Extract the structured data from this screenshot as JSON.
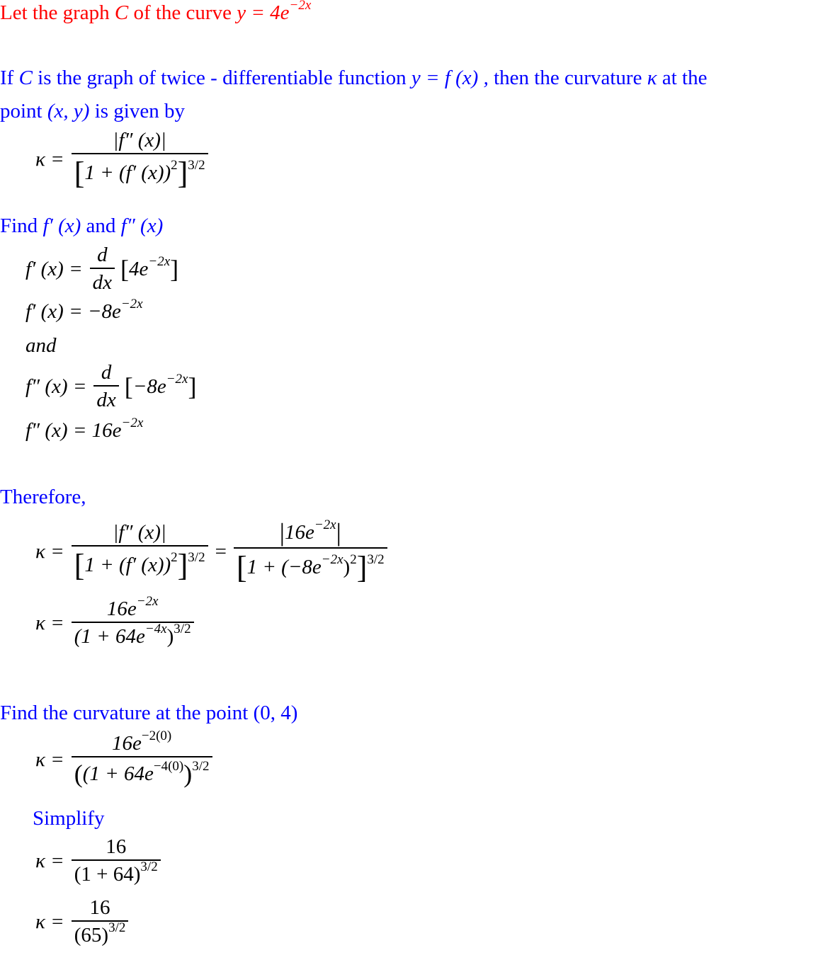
{
  "intro": {
    "text": "Let the graph C of the curve y = 4e^(−2x)",
    "prefix": "Let the graph ",
    "var_C": "C",
    "middle": " of the curve ",
    "equation": "y = 4e",
    "exponent": "−2x"
  },
  "definition": {
    "line1_prefix": "If ",
    "line1_C": "C",
    "line1_text": " is the graph of twice - differentiable function ",
    "line1_func": "y = f (x) ,",
    "line1_suffix": "  then the curvature ",
    "kappa": "κ",
    "line1_end": " at the",
    "line2_prefix": "point  ",
    "line2_point": "(x, y)",
    "line2_suffix": "  is given by",
    "formula_lhs": "κ =",
    "formula_num": "|f″ (x)|",
    "formula_den": "1 + (f′ (x))",
    "formula_den_sq": "2",
    "formula_exp": "3/2"
  },
  "derivatives": {
    "heading_prefix": "Find ",
    "heading_f1": "f′ (x)",
    "heading_and": "  and ",
    "heading_f2": "f″ (x)",
    "step1_lhs": "f′ (x) =",
    "step1_d": "d",
    "step1_dx": "dx",
    "step1_arg": "4e",
    "step1_arg_exp": "−2x",
    "step2_lhs": "f′ (x) =",
    "step2_rhs": "−8e",
    "step2_exp": "−2x",
    "and_text": "and",
    "step3_lhs": "f″ (x) =",
    "step3_d": "d",
    "step3_dx": "dx",
    "step3_arg": "−8e",
    "step3_arg_exp": "−2x",
    "step4_lhs": "f″ (x) =",
    "step4_rhs": "16e",
    "step4_exp": "−2x"
  },
  "therefore": {
    "heading": "Therefore,",
    "lhs": "κ =",
    "num1": "|f″ (x)|",
    "den1": "1 + (f′ (x))",
    "den1_sq": "2",
    "exp1": "3/2",
    "eq": "=",
    "num2": "16e",
    "num2_exp": "−2x",
    "den2": "1 + (−8e",
    "den2_inner_exp": "−2x",
    "den2_close": ")",
    "den2_sq": "2",
    "exp2": "3/2",
    "lhs2": "κ =",
    "num3": "16e",
    "num3_exp": "−2x",
    "den3": "(1 + 64e",
    "den3_inner_exp": "−4x",
    "den3_close": ")",
    "exp3": "3/2"
  },
  "evaluate": {
    "heading_prefix": "Find the curvature at the point  ",
    "heading_point": "(0, 4)",
    "lhs1": "κ =",
    "num1": "16e",
    "num1_exp": "−2(0)",
    "den1": "(1 + 64e",
    "den1_inner_exp": "−4(0)",
    "den1_close": ")",
    "exp1": "3/2",
    "simplify": "Simplify",
    "lhs2": "κ =",
    "num2": "16",
    "den2": "(1 + 64)",
    "exp2": "3/2",
    "lhs3": "κ =",
    "num3": "16",
    "den3": "(65)",
    "exp3": "3/2"
  },
  "colors": {
    "intro": "#ff0000",
    "headings": "#0000ff",
    "math": "#000000"
  }
}
